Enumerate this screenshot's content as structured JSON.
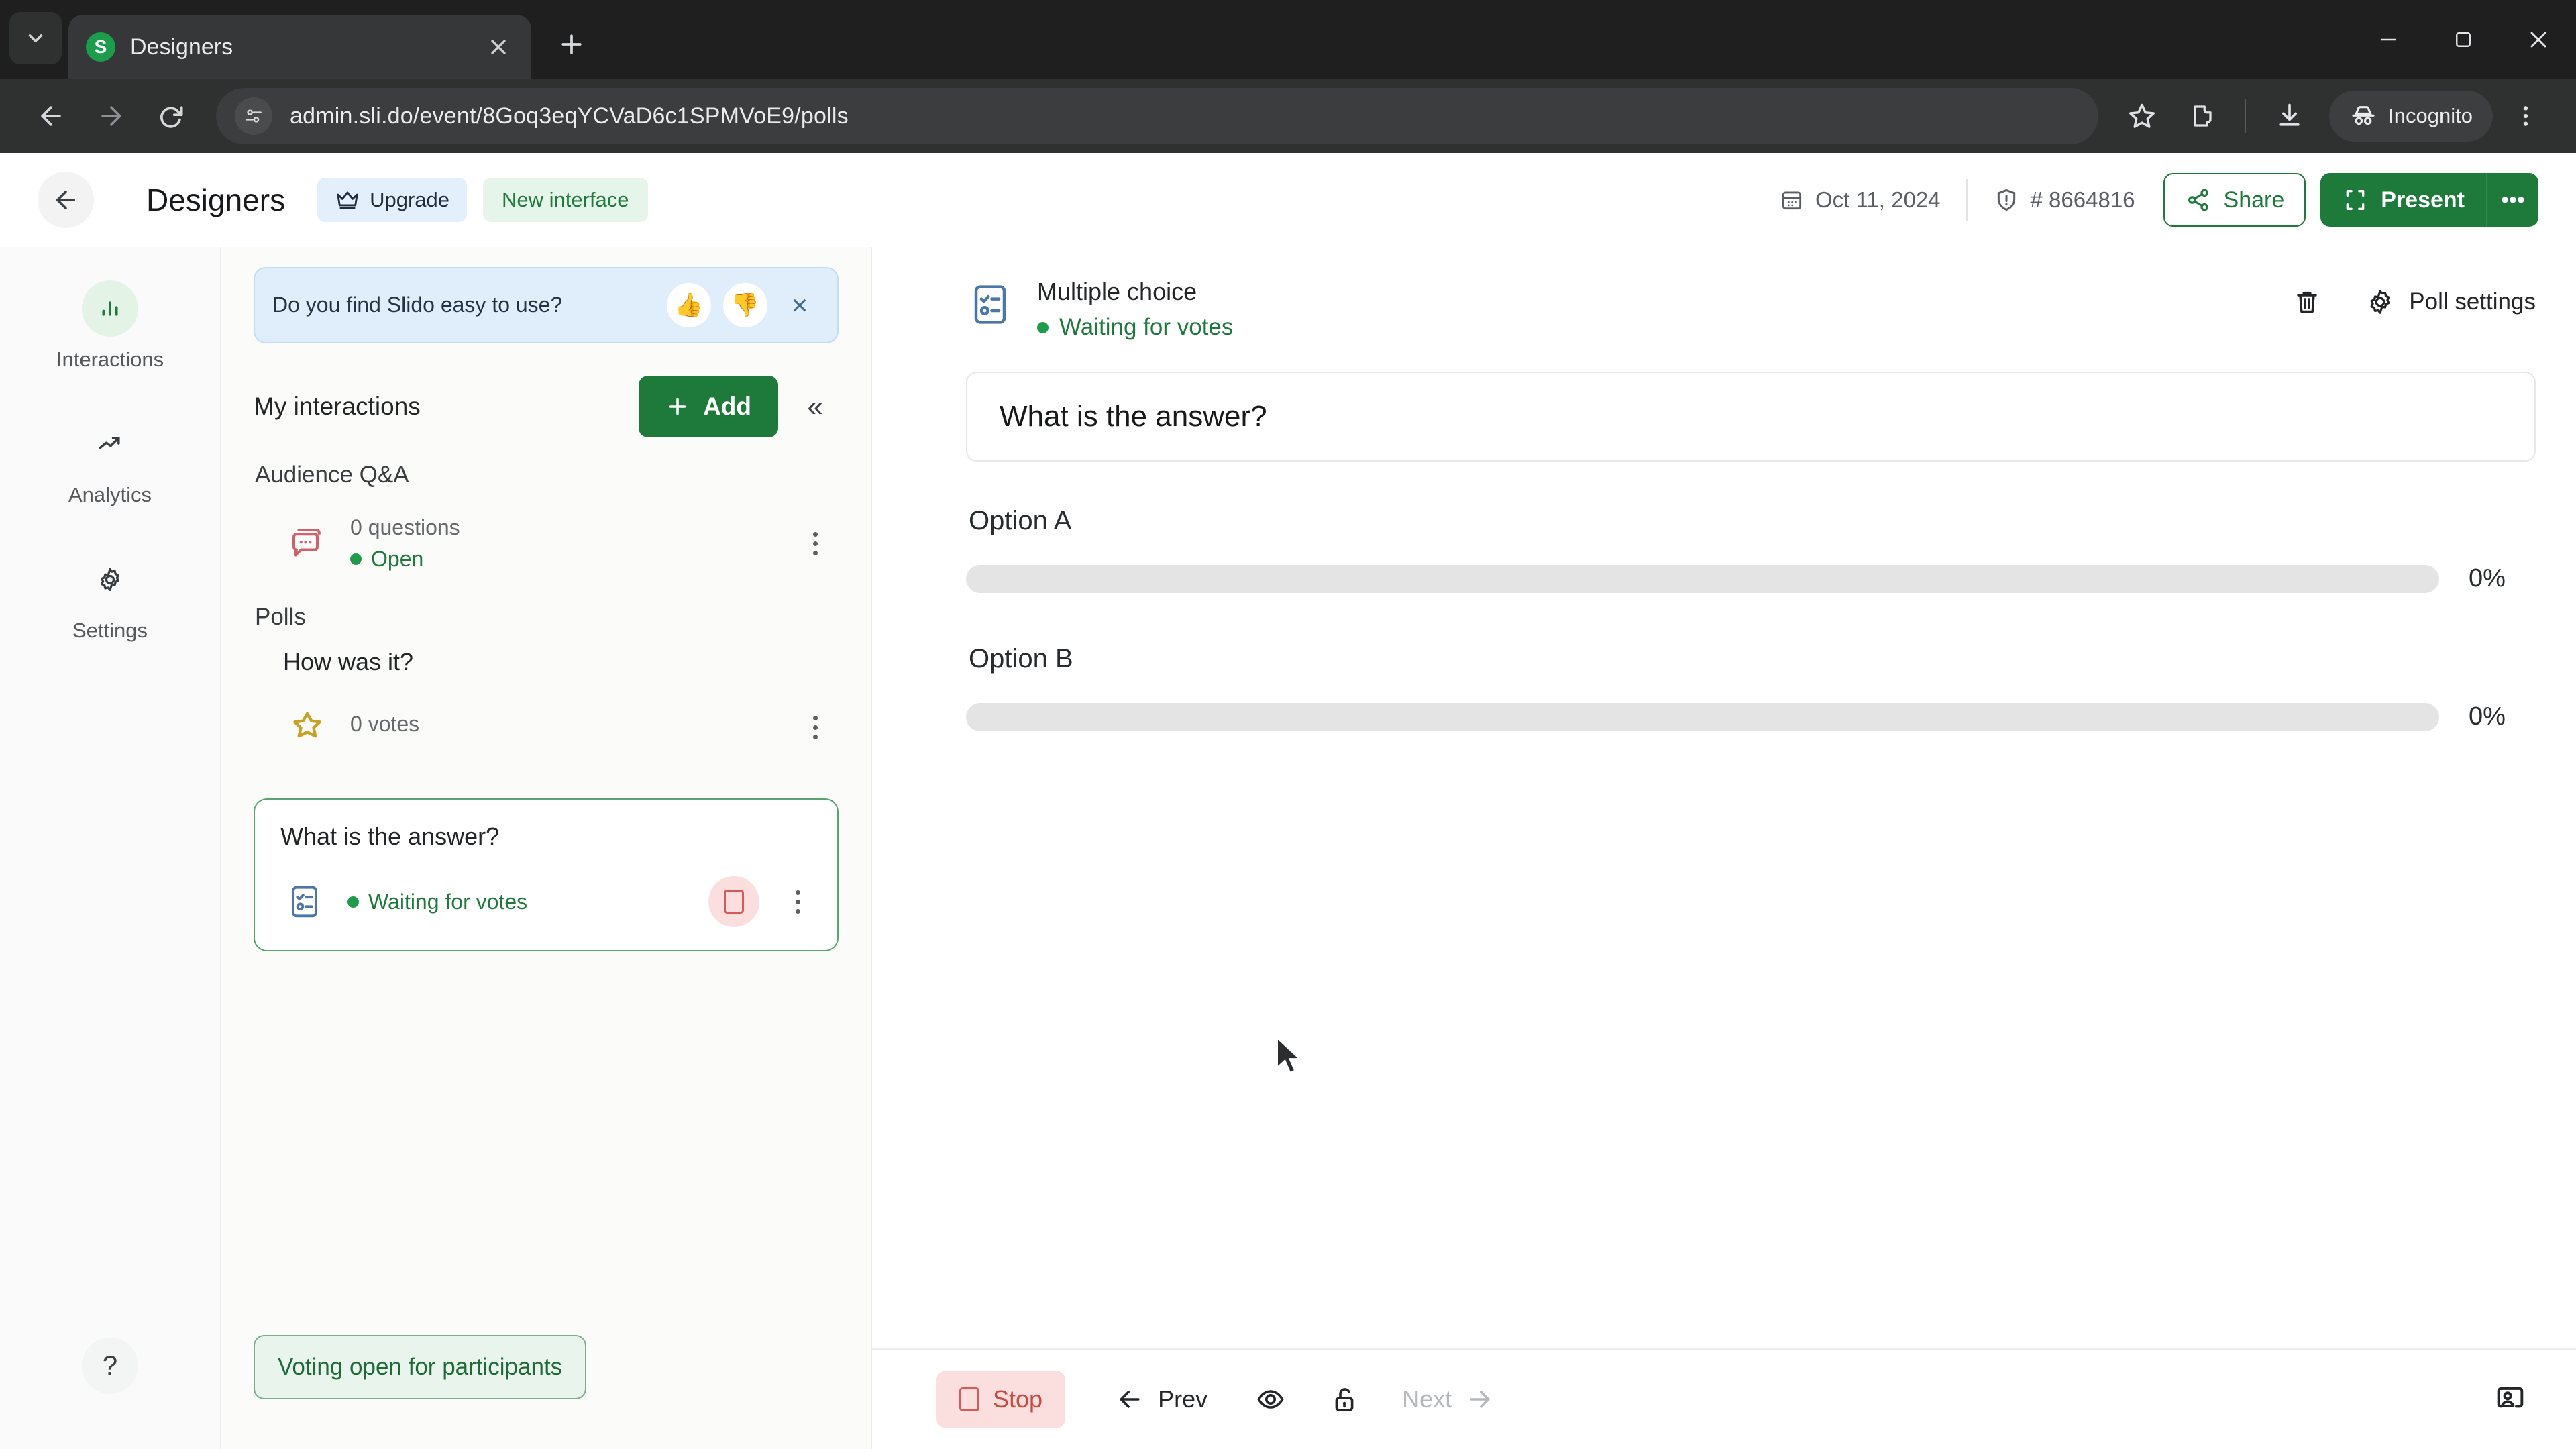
{
  "browser": {
    "tab": {
      "title": "Designers",
      "favicon_letter": "S"
    },
    "url": "admin.sli.do/event/8Goq3eqYCVaD6c1SPMVoE9/polls",
    "profile_label": "Incognito",
    "icons": {
      "tab_search": "chevron-down-icon",
      "tab_close": "close-icon",
      "new_tab": "plus-icon",
      "minimize": "minimize-icon",
      "maximize": "maximize-icon",
      "window_close": "close-icon",
      "back": "arrow-left-icon",
      "forward": "arrow-right-icon",
      "reload": "reload-icon",
      "site_info": "site-settings-icon",
      "bookmark": "star-icon",
      "extensions": "extensions-icon",
      "downloads": "download-icon",
      "incognito": "incognito-hat-icon",
      "menu": "three-dots-vertical-icon"
    }
  },
  "header": {
    "back_label": "back",
    "event_title": "Designers",
    "upgrade_label": "Upgrade",
    "new_interface_label": "New interface",
    "date": "Oct 11, 2024",
    "event_code": "# 8664816",
    "share_label": "Share",
    "present_label": "Present",
    "present_more_label": "•••"
  },
  "rail": {
    "items": [
      {
        "label": "Interactions",
        "icon": "bar-chart-icon",
        "active": true
      },
      {
        "label": "Analytics",
        "icon": "trending-up-icon",
        "active": false
      },
      {
        "label": "Settings",
        "icon": "gear-icon",
        "active": false
      }
    ],
    "help_label": "?"
  },
  "sidebar": {
    "feedback": {
      "question": "Do you find Slido easy to use?",
      "thumbs_up": "👍",
      "thumbs_down": "👎",
      "close_label": "×"
    },
    "my_interactions_label": "My interactions",
    "add_label": "Add",
    "collapse_label": "«",
    "groups": [
      {
        "label": "Audience Q&A",
        "items": [
          {
            "count": "0 questions",
            "status": "Open",
            "icon": "chat-bubble-icon"
          }
        ]
      },
      {
        "label": "Polls",
        "items": [
          {
            "title": "How was it?",
            "count": "0 votes",
            "icon": "star-icon"
          }
        ]
      }
    ],
    "selected_poll": {
      "title": "What is the answer?",
      "status": "Waiting for votes",
      "icon": "multiple-choice-icon",
      "stop_icon": "stop-square-icon"
    },
    "toast": "Voting open for participants"
  },
  "main": {
    "poll_type": "Multiple choice",
    "poll_status": "Waiting for votes",
    "delete_label": "delete",
    "poll_settings_label": "Poll settings",
    "question": "What is the answer?",
    "options": [
      {
        "label": "Option A",
        "percent": "0%",
        "value": 0
      },
      {
        "label": "Option B",
        "percent": "0%",
        "value": 0
      }
    ],
    "footer": {
      "stop_label": "Stop",
      "prev_label": "Prev",
      "next_label": "Next",
      "eye_icon": "eye-icon",
      "lock_icon": "unlock-icon",
      "presenter_icon": "participant-view-icon"
    }
  }
}
